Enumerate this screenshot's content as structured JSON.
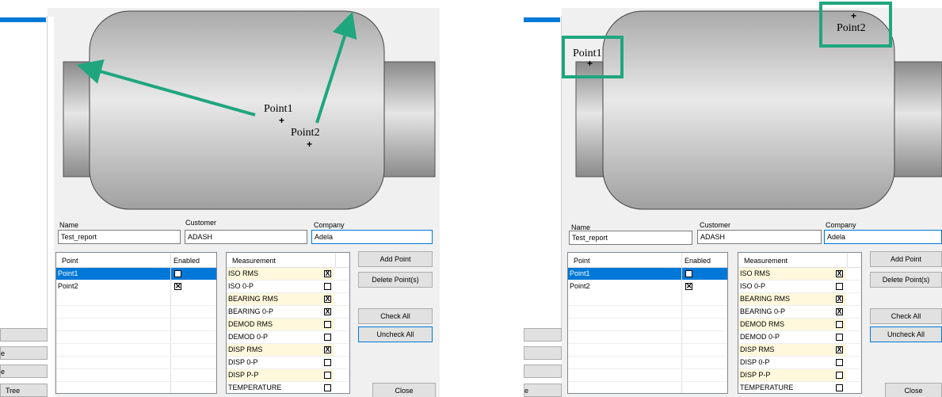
{
  "form": {
    "name_label": "Name",
    "customer_label": "Customer",
    "company_label": "Company",
    "name_value": "Test_report",
    "customer_value": "ADASH",
    "company_value": "Adela"
  },
  "points_table": {
    "col_point": "Point",
    "col_enabled": "Enabled",
    "rows": [
      {
        "name": "Point1",
        "enabled": "☒"
      },
      {
        "name": "Point2",
        "enabled": "☒"
      }
    ]
  },
  "measurements": {
    "header": "Measurement",
    "rows": [
      {
        "name": "ISO RMS",
        "check": "X"
      },
      {
        "name": "ISO 0-P",
        "check": ""
      },
      {
        "name": "BEARING RMS",
        "check": "X"
      },
      {
        "name": "BEARING 0-P",
        "check": "X"
      },
      {
        "name": "DEMOD RMS",
        "check": ""
      },
      {
        "name": "DEMOD 0-P",
        "check": ""
      },
      {
        "name": "DISP RMS",
        "check": "X"
      },
      {
        "name": "DISP 0-P",
        "check": ""
      },
      {
        "name": "DISP P-P",
        "check": ""
      },
      {
        "name": "TEMPERATURE",
        "check": ""
      }
    ]
  },
  "buttons": {
    "add_point": "Add Point",
    "delete_points": "Delete Point(s)",
    "check_all": "Check All",
    "uncheck_all": "Uncheck All",
    "close": "Close"
  },
  "side": {
    "left_partial_e1": "e",
    "left_partial_e2": "e",
    "left_tree": "Tree",
    "right_partial_e": "e"
  },
  "machine_points": {
    "p1": "Point1",
    "p2": "Point2",
    "plus": "+"
  },
  "colors": {
    "accent": "#0078d7",
    "arrow": "#1fa67e",
    "highlight_row": "#fff8dc"
  }
}
